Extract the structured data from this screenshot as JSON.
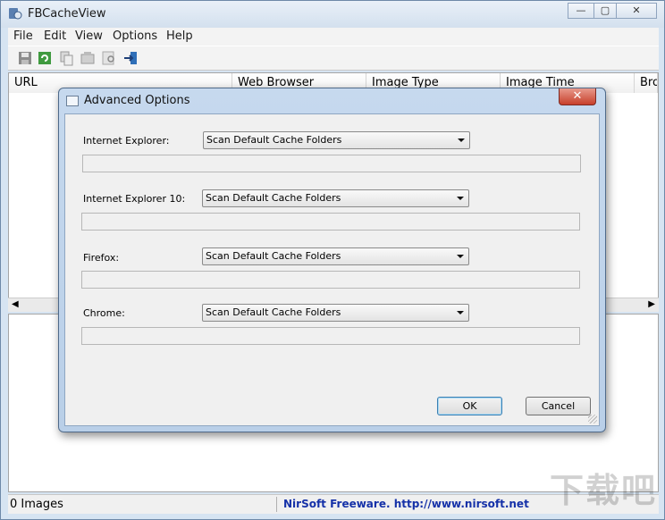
{
  "window": {
    "title": "FBCacheView",
    "buttons": {
      "minimize": "—",
      "restore": "▢",
      "close": "✕"
    }
  },
  "menu": [
    "File",
    "Edit",
    "View",
    "Options",
    "Help"
  ],
  "toolbar": {
    "icons": [
      "save-icon",
      "refresh-icon",
      "copy-icon",
      "properties-icon",
      "find-icon",
      "exit-icon"
    ]
  },
  "list": {
    "columns": [
      "URL",
      "Web Browser",
      "Image Type",
      "Image Time",
      "Bro"
    ]
  },
  "status": {
    "count": "0 Images",
    "credit": "NirSoft Freeware.  http://www.nirsoft.net"
  },
  "watermark": "下载吧",
  "dialog": {
    "title": "Advanced Options",
    "close": "✕",
    "rows": [
      {
        "label": "Internet Explorer:",
        "option": "Scan Default Cache Folders",
        "path": ""
      },
      {
        "label": "Internet Explorer 10:",
        "option": "Scan Default Cache Folders",
        "path": ""
      },
      {
        "label": "Firefox:",
        "option": "Scan Default Cache Folders",
        "path": ""
      },
      {
        "label": "Chrome:",
        "option": "Scan Default Cache Folders",
        "path": ""
      }
    ],
    "ok": "OK",
    "cancel": "Cancel"
  },
  "colors": {
    "status_link": "#1531a8",
    "dialog_frame": "#c6d9ee",
    "close_red": "#c7402b"
  }
}
